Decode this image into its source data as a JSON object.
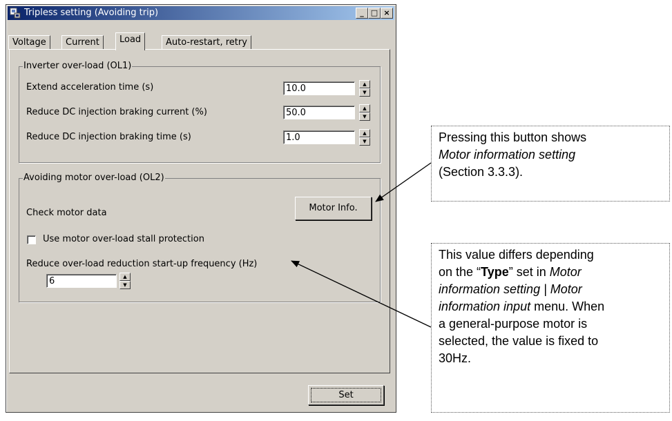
{
  "window": {
    "title": "Tripless setting (Avoiding trip)",
    "minimize": "_",
    "maximize": "□",
    "close": "×"
  },
  "tabs": [
    "Voltage",
    "Current",
    "Load",
    "Auto-restart, retry"
  ],
  "active_tab": "Load",
  "ol1": {
    "legend": "Inverter over-load (OL1)",
    "rows": [
      {
        "label": "Extend acceleration time (s)",
        "value": "10.0"
      },
      {
        "label": "Reduce DC injection braking current (%)",
        "value": "50.0"
      },
      {
        "label": "Reduce DC injection braking time (s)",
        "value": "1.0"
      }
    ]
  },
  "ol2": {
    "legend": "Avoiding motor over-load (OL2)",
    "check_label": "Check motor data",
    "motor_info_button": "Motor Info.",
    "stall_label": "Use motor over-load stall protection",
    "stall_checked": false,
    "freq_label": "Reduce over-load reduction start-up frequency (Hz)",
    "freq_value": "6"
  },
  "set_button": "Set",
  "callout1": {
    "line1": "Pressing this button shows",
    "line2": "Motor information setting",
    "line3": "(Section 3.3.3)."
  },
  "callout2": {
    "t1": "This value differs depending",
    "t2a": "on the “",
    "t2b": "Type",
    "t2c": "” set in ",
    "t2d": "Motor",
    "t3": "information setting | Motor",
    "t4a": "information input",
    "t4b": " menu. When",
    "t5": "a general-purpose motor is",
    "t6": "selected, the value is fixed to",
    "t7": "30Hz."
  }
}
